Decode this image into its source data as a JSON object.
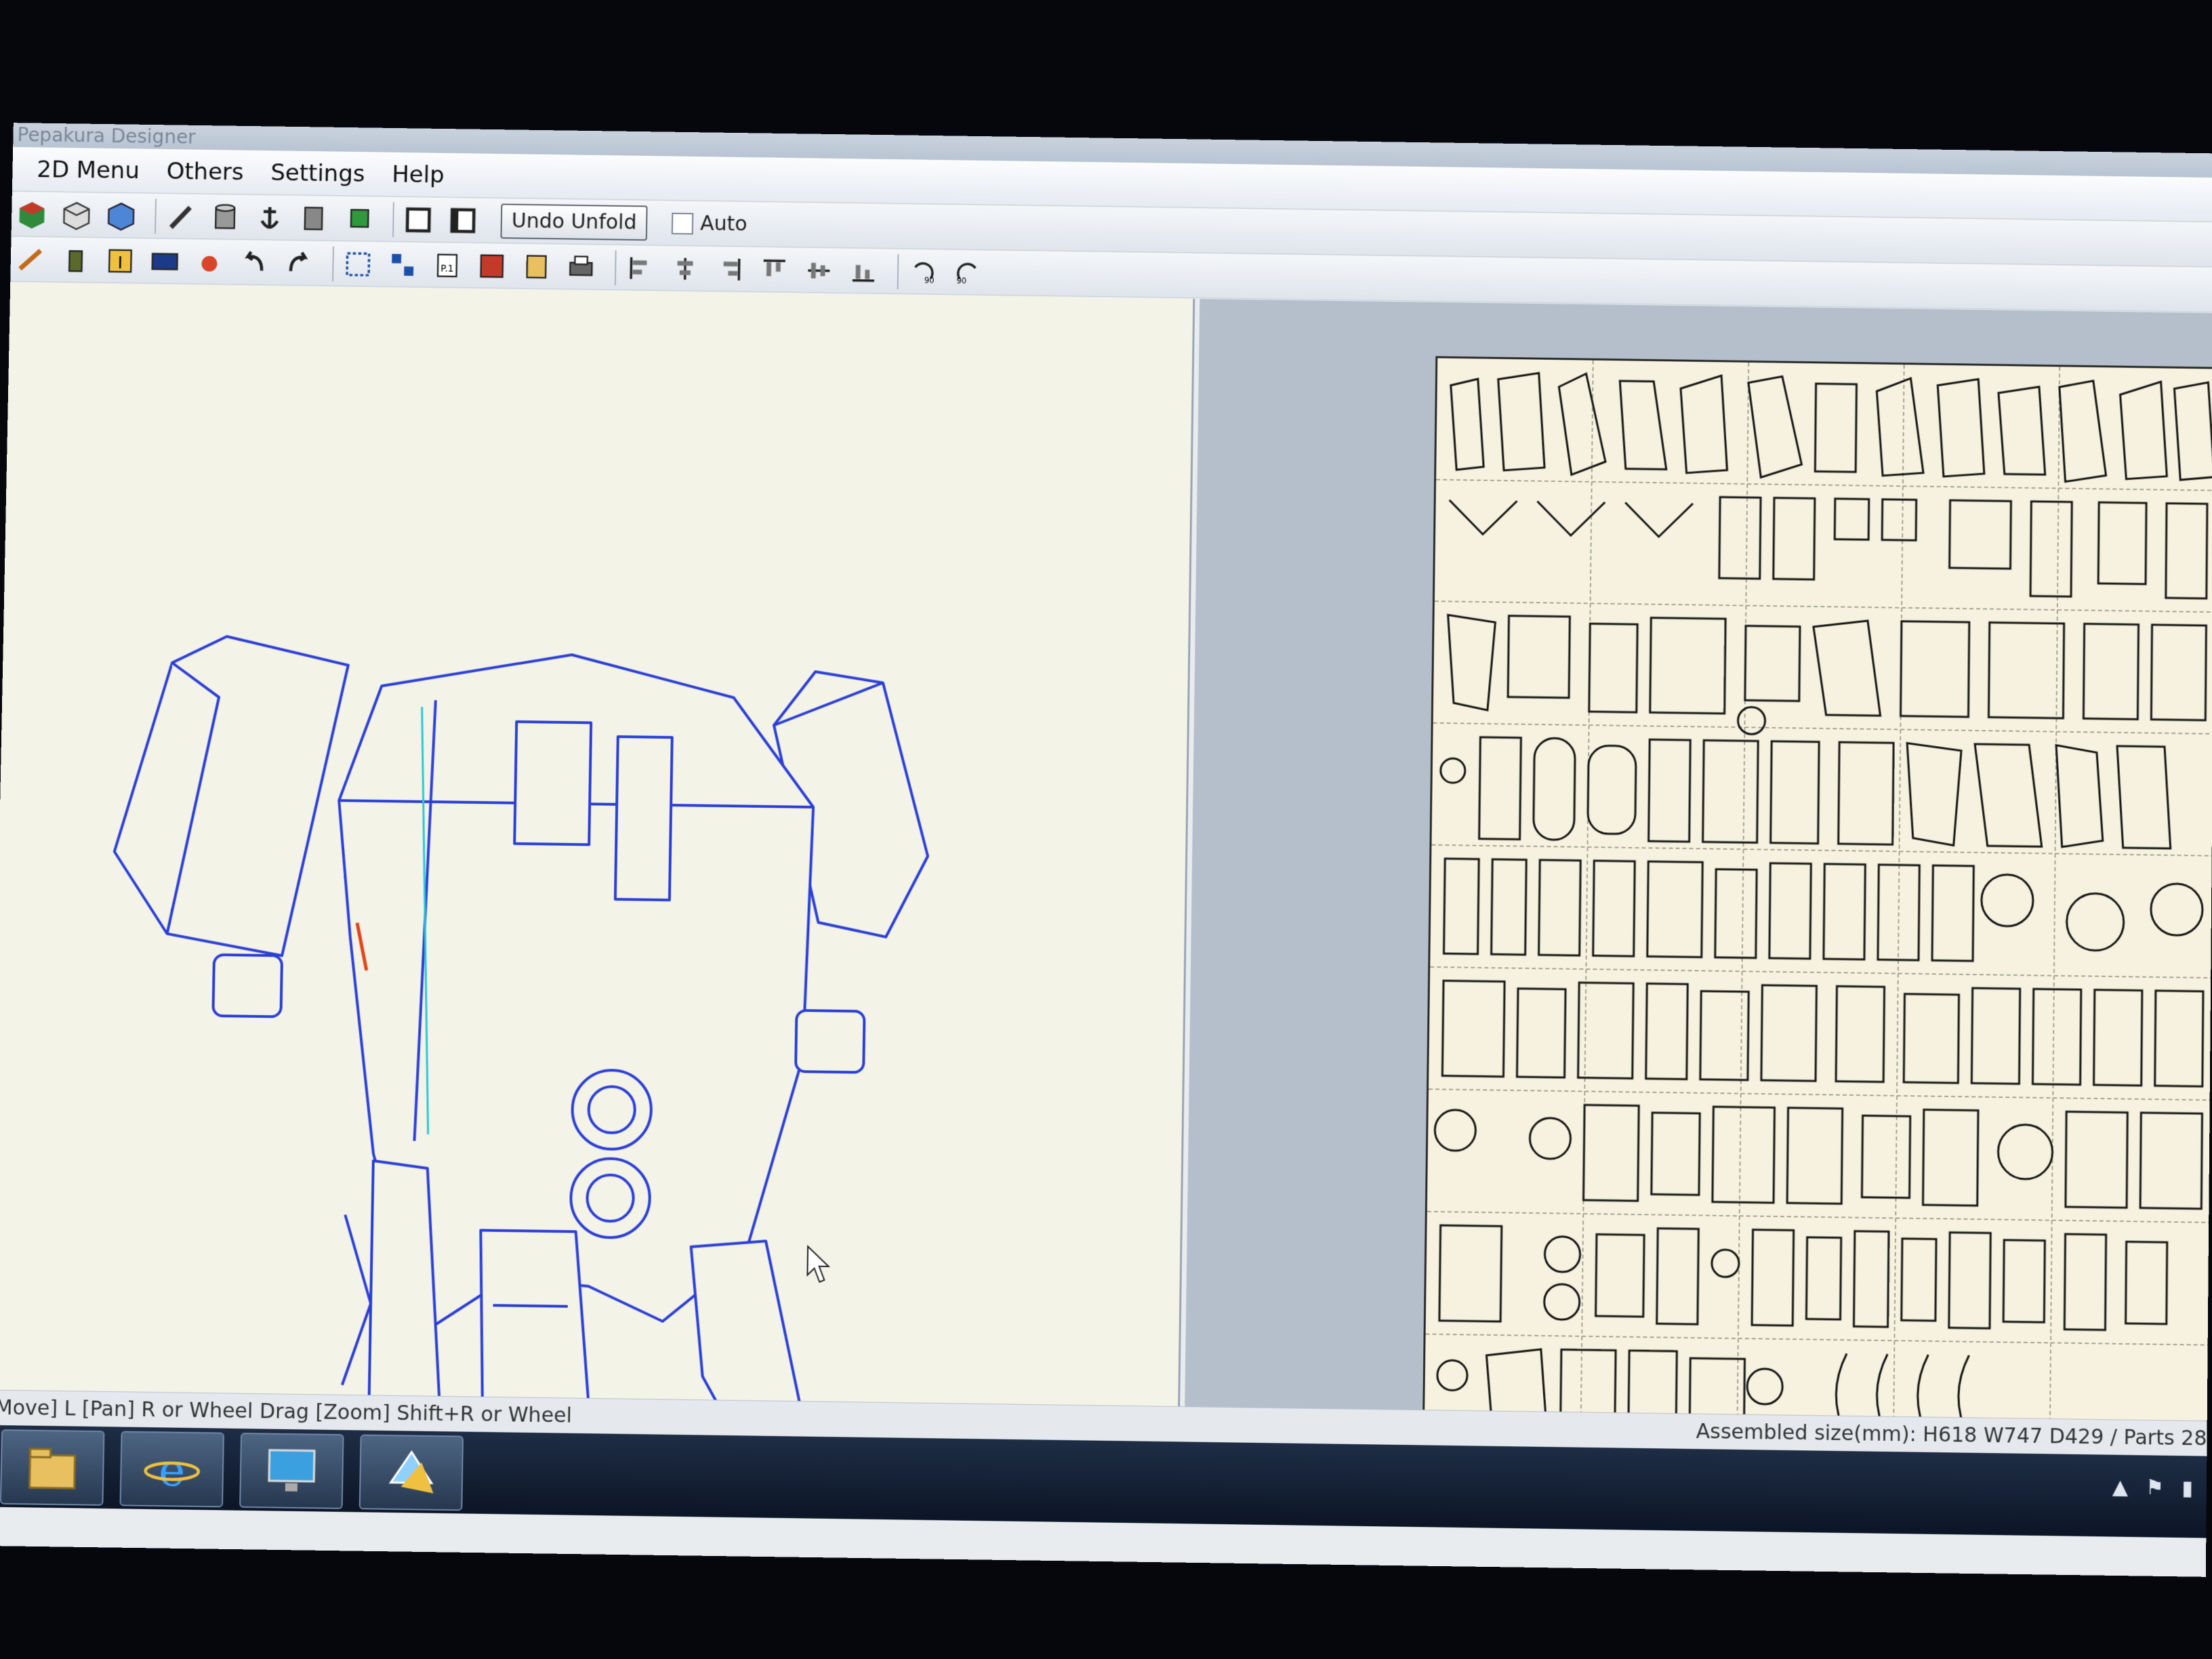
{
  "window": {
    "title": "Pepakura Designer"
  },
  "menu": {
    "items": [
      "2D Menu",
      "Others",
      "Settings",
      "Help"
    ]
  },
  "toolbar": {
    "undo_unfold_label": "Undo Unfold",
    "auto_label": "Auto",
    "auto_checked": false
  },
  "status": {
    "hint": "/Move] L [Pan] R or Wheel Drag [Zoom] Shift+R or Wheel",
    "assembled": "Assembled size(mm): H618 W747 D429 / Parts 28"
  },
  "colors": {
    "wireframe": "#2b3fd8",
    "seam_cyan": "#29c7d6",
    "seam_red": "#e0451a",
    "sheet": "#f6f2df"
  },
  "taskbar": {
    "apps": [
      "folder-icon",
      "internet-explorer-icon",
      "display-icon",
      "pepakura-icon"
    ]
  }
}
